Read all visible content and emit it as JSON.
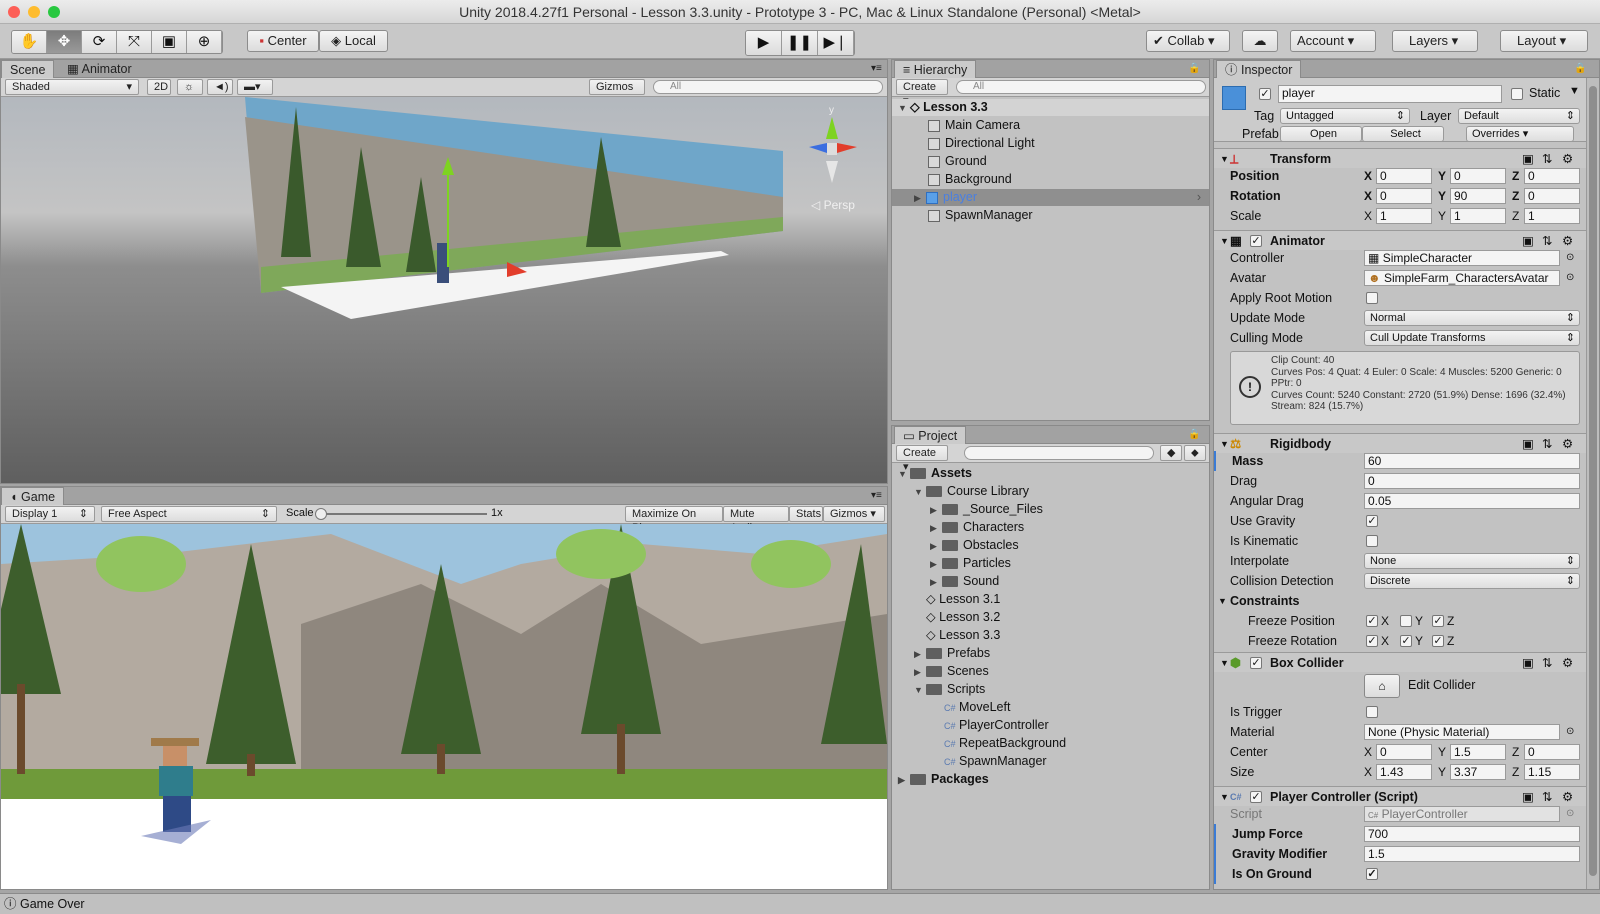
{
  "window": {
    "title": "Unity 2018.4.27f1 Personal - Lesson 3.3.unity - Prototype 3 - PC, Mac & Linux Standalone (Personal) <Metal>"
  },
  "toolbar": {
    "center": "Center",
    "local": "Local",
    "collab": "Collab",
    "account": "Account",
    "layers": "Layers",
    "layout": "Layout"
  },
  "scene": {
    "tab": "Scene",
    "tab2": "Animator",
    "shading": "Shaded",
    "twod": "2D",
    "gizmos": "Gizmos",
    "search": "All",
    "persp": "Persp",
    "axis_y": "y"
  },
  "game": {
    "tab": "Game",
    "display": "Display 1",
    "aspect": "Free Aspect",
    "scale_label": "Scale",
    "scale_value": "1x",
    "maximize": "Maximize On Play",
    "mute": "Mute Audio",
    "stats": "Stats",
    "gizmos": "Gizmos"
  },
  "hierarchy": {
    "tab": "Hierarchy",
    "create": "Create",
    "search": "All",
    "scene": "Lesson 3.3",
    "items": [
      "Main Camera",
      "Directional Light",
      "Ground",
      "Background",
      "player",
      "SpawnManager"
    ]
  },
  "project": {
    "tab": "Project",
    "create": "Create",
    "tree": [
      "Assets",
      "Course Library",
      "_Source_Files",
      "Characters",
      "Obstacles",
      "Particles",
      "Sound",
      "Lesson 3.1",
      "Lesson 3.2",
      "Lesson 3.3",
      "Prefabs",
      "Scenes",
      "Scripts",
      "MoveLeft",
      "PlayerController",
      "RepeatBackground",
      "SpawnManager",
      "Packages"
    ]
  },
  "inspector": {
    "tab": "Inspector",
    "name": "player",
    "static": "Static",
    "tag_label": "Tag",
    "tag": "Untagged",
    "layer_label": "Layer",
    "layer": "Default",
    "prefab_label": "Prefab",
    "open": "Open",
    "select": "Select",
    "overrides": "Overrides",
    "transform": {
      "title": "Transform",
      "position": "Position",
      "rotation": "Rotation",
      "scale": "Scale",
      "pos": [
        "0",
        "0",
        "0"
      ],
      "rot": [
        "0",
        "90",
        "0"
      ],
      "scl": [
        "1",
        "1",
        "1"
      ]
    },
    "animator": {
      "title": "Animator",
      "controller_label": "Controller",
      "controller": "SimpleCharacter",
      "avatar_label": "Avatar",
      "avatar": "SimpleFarm_CharactersAvatar",
      "root_motion": "Apply Root Motion",
      "update_label": "Update Mode",
      "update": "Normal",
      "culling_label": "Culling Mode",
      "culling": "Cull Update Transforms",
      "info1": "Clip Count: 40",
      "info2": "Curves Pos: 4 Quat: 4 Euler: 0 Scale: 4 Muscles: 5200 Generic: 0 PPtr: 0",
      "info3": "Curves Count: 5240 Constant: 2720 (51.9%) Dense: 1696 (32.4%) Stream: 824 (15.7%)"
    },
    "rigidbody": {
      "title": "Rigidbody",
      "mass_label": "Mass",
      "mass": "60",
      "drag_label": "Drag",
      "drag": "0",
      "adrag_label": "Angular Drag",
      "adrag": "0.05",
      "gravity": "Use Gravity",
      "kinematic": "Is Kinematic",
      "interp_label": "Interpolate",
      "interp": "None",
      "coll_label": "Collision Detection",
      "coll": "Discrete",
      "constraints": "Constraints",
      "freeze_pos": "Freeze Position",
      "freeze_rot": "Freeze Rotation"
    },
    "box": {
      "title": "Box Collider",
      "edit": "Edit Collider",
      "trigger": "Is Trigger",
      "material_label": "Material",
      "material": "None (Physic Material)",
      "center_label": "Center",
      "center": [
        "0",
        "1.5",
        "0"
      ],
      "size_label": "Size",
      "size": [
        "1.43",
        "3.37",
        "1.15"
      ]
    },
    "script": {
      "title": "Player Controller (Script)",
      "script_label": "Script",
      "script": "PlayerController",
      "jump_label": "Jump Force",
      "jump": "700",
      "grav_label": "Gravity Modifier",
      "grav": "1.5",
      "ground_label": "Is On Ground"
    }
  },
  "status": {
    "text": "Game Over"
  },
  "axes": {
    "x": "X",
    "y": "Y",
    "z": "Z"
  }
}
